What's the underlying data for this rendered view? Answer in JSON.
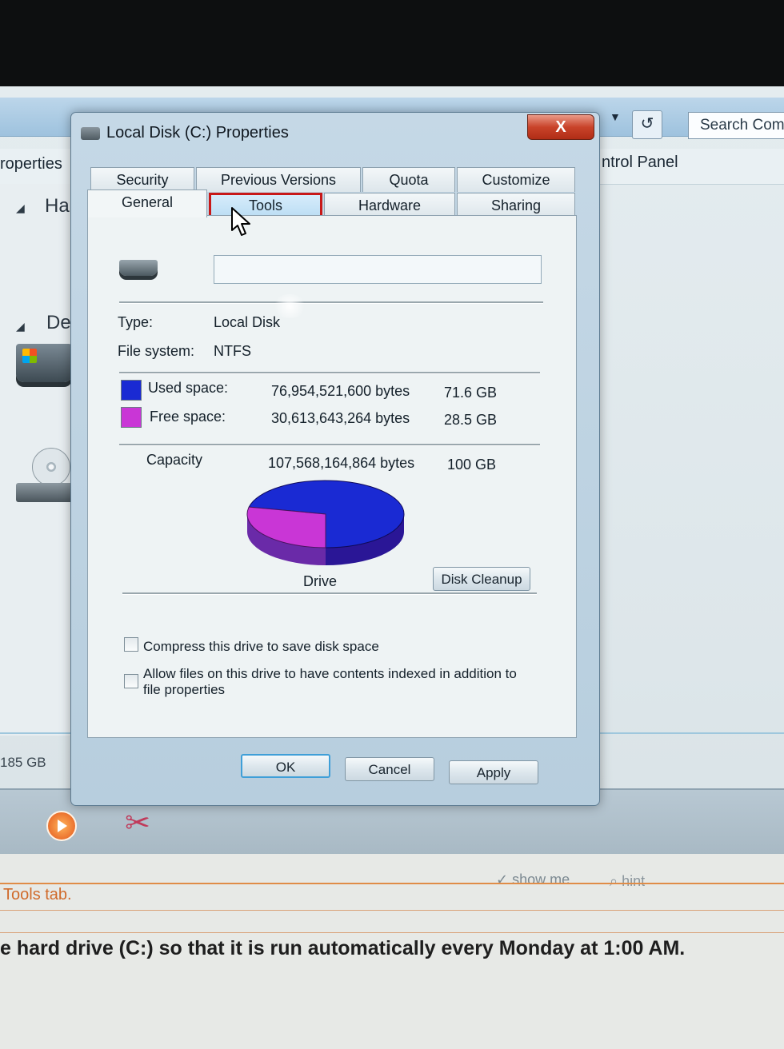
{
  "explorer": {
    "search_placeholder": "Search Com",
    "refresh_icon": "↺",
    "dropdown_icon": "▼",
    "left_crumb": "roperties",
    "right_crumb": "ntrol Panel",
    "tree": {
      "hard_drives": "Ha",
      "devices": "De"
    },
    "status_size": "185 GB"
  },
  "dialog": {
    "title": "Local Disk (C:) Properties",
    "close_icon": "X",
    "tabs_row1": [
      "Security",
      "Previous Versions",
      "Quota",
      "Customize"
    ],
    "tabs_row2": [
      "General",
      "Tools",
      "Hardware",
      "Sharing"
    ],
    "drive_label_value": "",
    "type_label": "Type:",
    "type_value": "Local Disk",
    "fs_label": "File system:",
    "fs_value": "NTFS",
    "used": {
      "label": "Used space:",
      "bytes": "76,954,521,600 bytes",
      "size": "71.6 GB",
      "color": "#1a2ad3"
    },
    "free": {
      "label": "Free space:",
      "bytes": "30,613,643,264 bytes",
      "size": "28.5 GB",
      "color": "#c936d6"
    },
    "capacity": {
      "label": "Capacity",
      "bytes": "107,568,164,864 bytes",
      "size": "100 GB"
    },
    "pie_label": "Drive",
    "used_fraction": 0.716,
    "disk_cleanup": "Disk Cleanup",
    "compress_label": "Compress this drive to save disk space",
    "index_label_line1": "Allow files on this drive to have contents indexed in addition to",
    "index_label_line2": "file properties",
    "ok": "OK",
    "cancel": "Cancel",
    "apply": "Apply"
  },
  "tutorial": {
    "show_me": "show me",
    "hint": "hint",
    "step": "Tools tab.",
    "instruction": "e hard drive (C:) so that it is run automatically every Monday at 1:00 AM."
  }
}
